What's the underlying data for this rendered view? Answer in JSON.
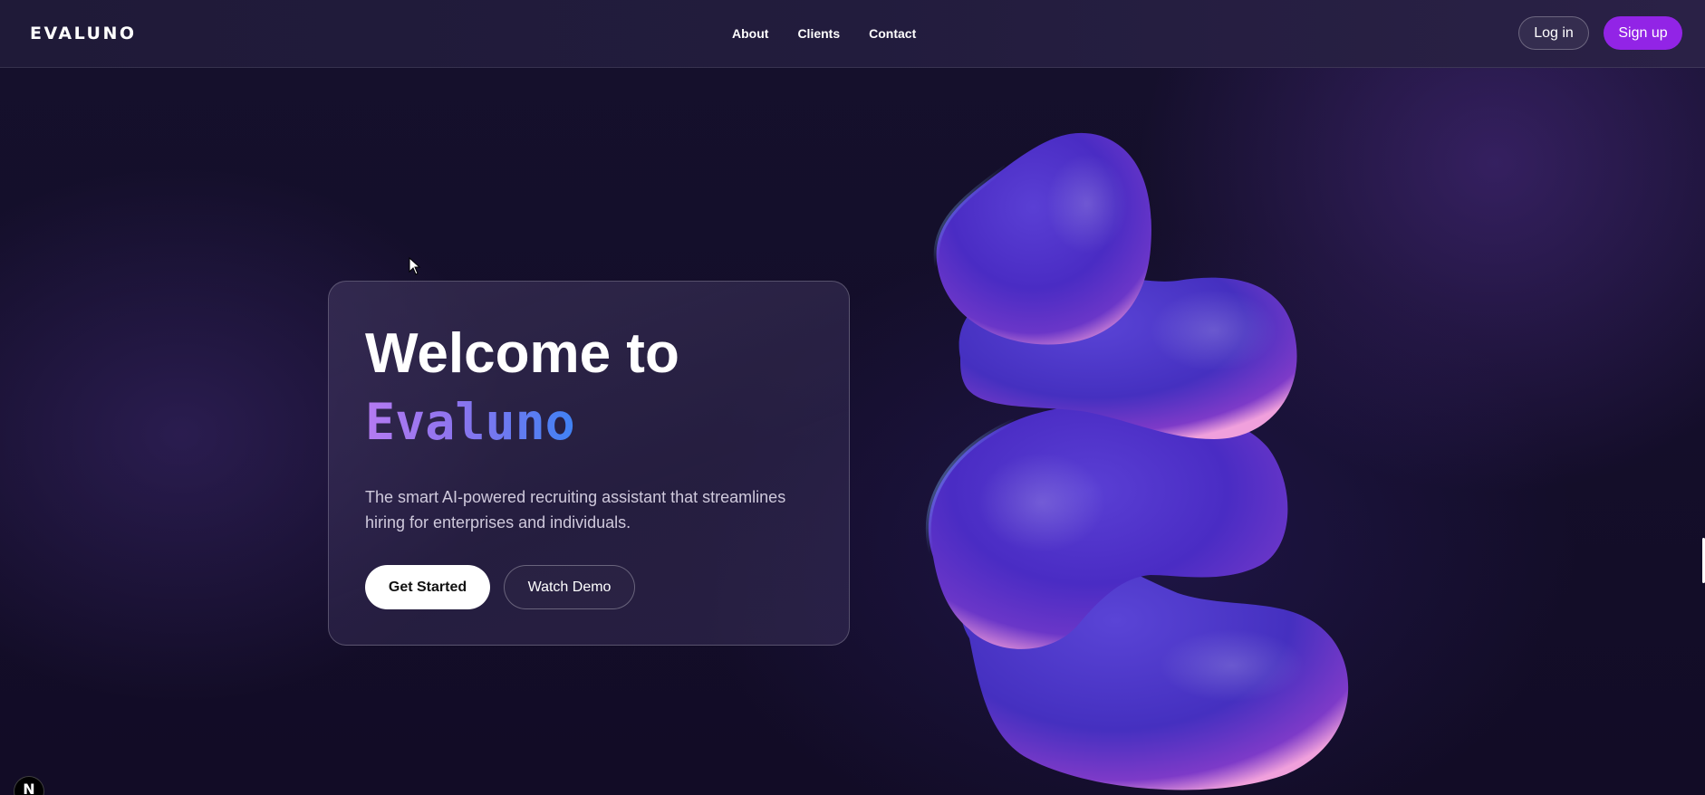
{
  "navbar": {
    "brand": "EVALUNO",
    "links": [
      "About",
      "Clients",
      "Contact"
    ],
    "login_label": "Log in",
    "signup_label": "Sign up"
  },
  "hero": {
    "title_line1": "Welcome to",
    "title_line2": "Evaluno",
    "subtitle": "The smart AI-powered recruiting assistant that streamlines hiring for enterprises and individuals.",
    "primary_button": "Get Started",
    "secondary_button": "Watch Demo"
  },
  "devtools_badge": {
    "icon": "nextjs-logo-icon",
    "letter": "N"
  },
  "colors": {
    "background": "#140f2b",
    "navbar": "#221c3d",
    "accent": "#9224e6",
    "gradient_start": "#b57bf2",
    "gradient_end": "#3f82f4"
  }
}
